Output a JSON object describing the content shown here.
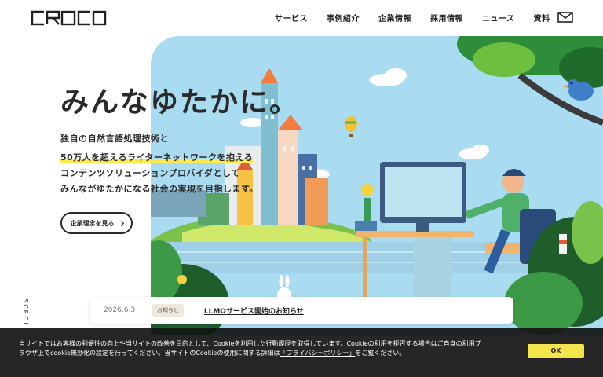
{
  "header": {
    "logo_text": "CROCO",
    "nav": [
      "サービス",
      "事例紹介",
      "企業情報",
      "採用情報",
      "ニュース",
      "資料"
    ]
  },
  "hero": {
    "headline": "みんなゆたかに。",
    "sub_line1": "独自の自然言語処理技術と",
    "sub_line2": "50万人を超えるライターネットワークを抱える",
    "sub_line3": "コンテンツソリューションプロバイダとして",
    "sub_line4": "みんながゆたかになる社会の実現を目指します。",
    "philosophy_button": "企業理念を見る",
    "scroll_label": "SCROLL"
  },
  "news": {
    "date": "2026.6.3",
    "badge": "お知らせ",
    "title": "LLMOサービス開始のお知らせ"
  },
  "cookie": {
    "text_before": "当サイトではお客様の利便性の向上や当サイトの改善を目的として、Cookieを利用した行動履歴を取得しています。Cookieの利用を拒否する場合はご自身の利用ブラウザ上でcookie無効化の設定を行ってください。当サイトのCookieの使用に関する詳細は",
    "link": "「プライバシーポリシー」",
    "text_after": "をご覧ください。",
    "ok_label": "OK"
  },
  "colors": {
    "sky": "#a9dbf1",
    "highlight": "#fbe94e",
    "ok_button": "#f3e44b",
    "cookie_bg": "#141414"
  }
}
